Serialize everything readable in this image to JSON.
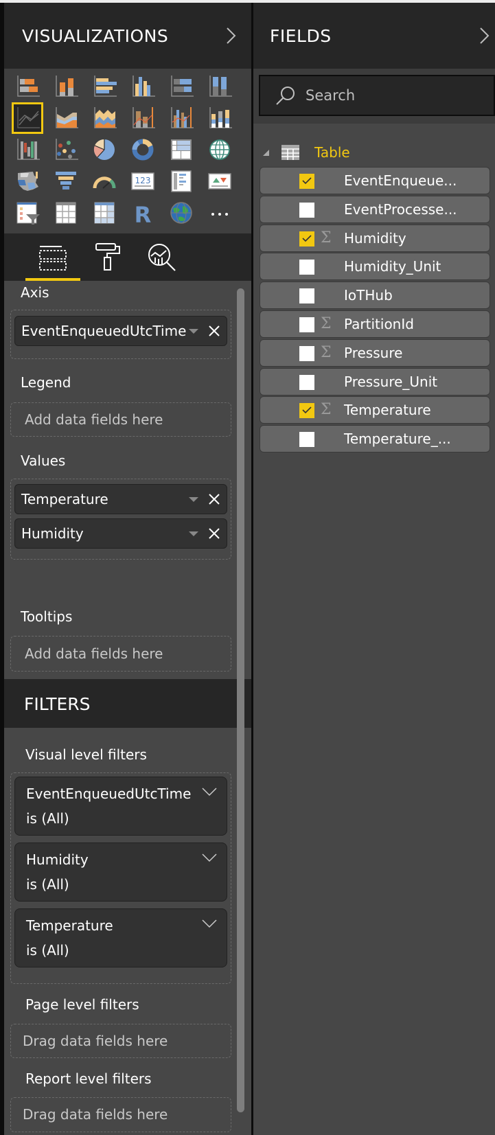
{
  "visualizations": {
    "title": "VISUALIZATIONS",
    "icons": [
      "stacked-bar-chart-icon",
      "stacked-column-chart-icon",
      "clustered-bar-chart-icon",
      "clustered-column-chart-icon",
      "100-percent-stacked-bar-chart-icon",
      "100-percent-stacked-column-chart-icon",
      "line-chart-icon",
      "area-chart-icon",
      "stacked-area-chart-icon",
      "line-and-stacked-column-chart-icon",
      "line-and-clustered-column-chart-icon",
      "ribbon-chart-icon",
      "waterfall-chart-icon",
      "scatter-chart-icon",
      "pie-chart-icon",
      "donut-chart-icon",
      "treemap-icon",
      "map-icon",
      "filled-map-icon",
      "funnel-icon",
      "gauge-icon",
      "card-icon",
      "multi-row-card-icon",
      "kpi-icon",
      "slicer-icon",
      "table-icon",
      "matrix-icon",
      "r-script-visual-icon",
      "arcgis-map-icon",
      "more-visuals-icon"
    ],
    "selected_icon": "line-chart-icon",
    "tabs": [
      {
        "name": "fields-tab",
        "icon": "fields-wells-icon",
        "active": true
      },
      {
        "name": "format-tab",
        "icon": "paint-roller-icon",
        "active": false
      },
      {
        "name": "analytics-tab",
        "icon": "analytics-magnifier-icon",
        "active": false
      }
    ],
    "wells": {
      "axis": {
        "label": "Axis",
        "fields": [
          "EventEnqueuedUtcTime"
        ]
      },
      "legend": {
        "label": "Legend",
        "placeholder": "Add data fields here"
      },
      "values": {
        "label": "Values",
        "fields": [
          "Temperature",
          "Humidity"
        ]
      },
      "tooltips": {
        "label": "Tooltips",
        "placeholder": "Add data fields here"
      }
    }
  },
  "filters": {
    "title": "FILTERS",
    "visual_level": {
      "label": "Visual level filters",
      "cards": [
        {
          "field": "EventEnqueuedUtcTime",
          "condition": "is (All)"
        },
        {
          "field": "Humidity",
          "condition": "is (All)"
        },
        {
          "field": "Temperature",
          "condition": "is (All)"
        }
      ]
    },
    "page_level": {
      "label": "Page level filters",
      "placeholder": "Drag data fields here"
    },
    "report_level": {
      "label": "Report level filters",
      "placeholder": "Drag data fields here"
    }
  },
  "fields": {
    "title": "FIELDS",
    "search_placeholder": "Search",
    "table_name": "Table",
    "items": [
      {
        "name": "EventEnqueue...",
        "checked": true,
        "sigma": false
      },
      {
        "name": "EventProcesse...",
        "checked": false,
        "sigma": false
      },
      {
        "name": "Humidity",
        "checked": true,
        "sigma": true
      },
      {
        "name": "Humidity_Unit",
        "checked": false,
        "sigma": false
      },
      {
        "name": "IoTHub",
        "checked": false,
        "sigma": false
      },
      {
        "name": "PartitionId",
        "checked": false,
        "sigma": true
      },
      {
        "name": "Pressure",
        "checked": false,
        "sigma": true
      },
      {
        "name": "Pressure_Unit",
        "checked": false,
        "sigma": false
      },
      {
        "name": "Temperature",
        "checked": true,
        "sigma": true
      },
      {
        "name": "Temperature_...",
        "checked": false,
        "sigma": false
      }
    ],
    "sigma_symbol": "Σ"
  },
  "colors": {
    "accent": "#f2c811",
    "pane_bg": "#474747",
    "header_bg": "#262626"
  }
}
